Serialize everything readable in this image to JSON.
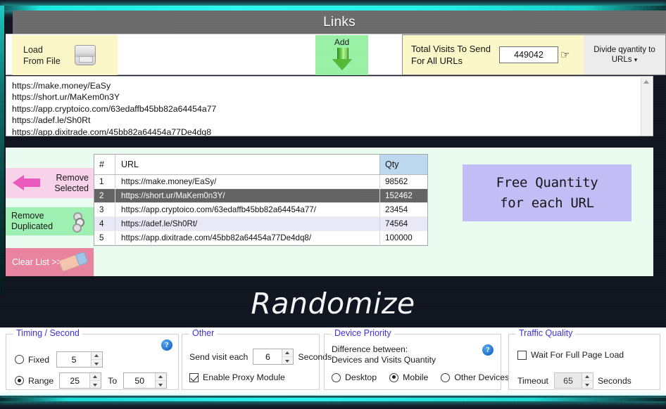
{
  "window": {
    "title": "Links"
  },
  "toolbar": {
    "load_from_file_label": "Load\nFrom File",
    "add_label": "Add",
    "total_visits_label": "Total Visits To Send\nFor All URLs",
    "total_visits_value": "449042",
    "divide_label": "Divide qyantity to\nURLs",
    "divide_caret": "▾"
  },
  "url_textarea": {
    "lines": [
      "https://make.money/EaSy",
      "https://short.ur/MaKem0n3Y",
      "https://app.cryptoico.com/63edaffb45bb82a64454a77",
      "https://adef.le/Sh0Rt",
      "https://app.dixitrade.com/45bb82a64454a77De4dq8"
    ]
  },
  "side_buttons": {
    "remove_selected": "Remove\nSelected",
    "remove_duplicated": "Remove\nDuplicated",
    "clear_list": "Clear List >>"
  },
  "table": {
    "headers": [
      "#",
      "URL",
      "Qty"
    ],
    "rows": [
      {
        "num": "1",
        "url": "https://make.money/EaSy/",
        "qty": "98562"
      },
      {
        "num": "2",
        "url": "https://short.ur/MaKem0n3Y/",
        "qty": "152462"
      },
      {
        "num": "3",
        "url": "https://app.cryptoico.com/63edaffb45bb82a64454a77/",
        "qty": "23454"
      },
      {
        "num": "4",
        "url": "https://adef.le/Sh0Rt/",
        "qty": "74564"
      },
      {
        "num": "5",
        "url": "https://app.dixitrade.com/45bb82a64454a77De4dq8/",
        "qty": "100000"
      }
    ]
  },
  "callout": {
    "line1": "Free Quantity",
    "line2": "for each URL"
  },
  "randomize_heading": "Randomize",
  "bottom": {
    "timing": {
      "legend": "Timing / Second",
      "fixed_label": "Fixed",
      "fixed_value": "5",
      "range_label": "Range",
      "range_from": "25",
      "to_label": "To",
      "range_to": "50",
      "help": "?"
    },
    "other": {
      "legend": "Other",
      "send_visit_label": "Send visit each",
      "send_visit_value": "6",
      "seconds_label": "Seconds",
      "enable_proxy_label": "Enable Proxy Module"
    },
    "device": {
      "legend": "Device Priority",
      "description": "Difference between:\nDevices and Visits Quantity",
      "desktop_label": "Desktop",
      "mobile_label": "Mobile",
      "other_devices_label": "Other Devices",
      "help": "?"
    },
    "traffic": {
      "legend": "Traffic Quality",
      "wait_full_page_label": "Wait For Full Page Load",
      "timeout_label": "Timeout",
      "timeout_value": "65",
      "seconds_label": "Seconds"
    }
  },
  "colors": {
    "title_bar": "#6b6b6b",
    "load_button": "#fbf7c8",
    "add_button": "#98f0a5",
    "mint_panel": "#eafbf0",
    "remove_selected": "#f8d2e8",
    "remove_duplicated": "#9ef0b2",
    "clear_list": "#e8839f",
    "callout": "#c3bdf7",
    "qty_header": "#bcd8ef",
    "selected_row": "#636363",
    "legend_text": "#3b2fe0",
    "glow": "#2ff5ef"
  }
}
